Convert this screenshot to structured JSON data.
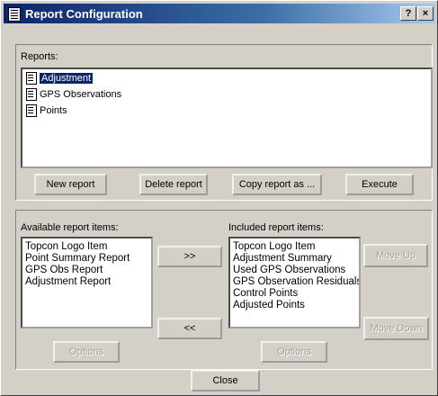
{
  "window": {
    "title": "Report Configuration",
    "help_label": "?",
    "close_label": "×"
  },
  "reports": {
    "label": "Reports:",
    "items": [
      {
        "label": "Adjustment",
        "selected": true
      },
      {
        "label": "GPS Observations",
        "selected": false
      },
      {
        "label": "Points",
        "selected": false
      }
    ]
  },
  "report_buttons": {
    "new": "New report",
    "delete": "Delete report",
    "copy": "Copy report as ...",
    "execute": "Execute"
  },
  "available": {
    "label": "Available report items:",
    "items": [
      "Topcon Logo Item",
      "Point Summary Report",
      "GPS Obs Report",
      "Adjustment Report"
    ],
    "options_label": "Options"
  },
  "transfer": {
    "add_label": ">>",
    "remove_label": "<<"
  },
  "included": {
    "label": "Included report items:",
    "items": [
      "Topcon Logo Item",
      "Adjustment Summary",
      "Used GPS Observations",
      "GPS Observation Residuals",
      "Control Points",
      "Adjusted Points"
    ],
    "options_label": "Options",
    "move_up_label": "Move Up",
    "move_down_label": "Move Down"
  },
  "footer": {
    "close_label": "Close"
  }
}
